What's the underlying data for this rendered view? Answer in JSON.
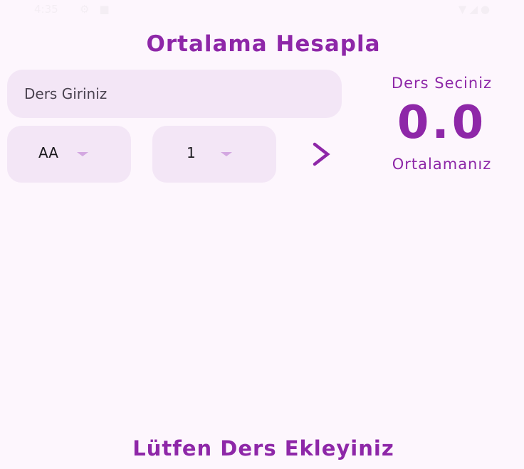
{
  "status_bar": {
    "time": "4:35",
    "icons": [
      "settings-gear-icon",
      "android-robot-icon",
      "wifi-icon",
      "signal-icon",
      "battery-icon"
    ]
  },
  "header": {
    "title": "Ortalama Hesapla"
  },
  "form": {
    "course_placeholder": "Ders Giriniz",
    "grade_selected": "AA",
    "credit_selected": "1"
  },
  "summary": {
    "select_label": "Ders Seciniz",
    "average_value": "0.0",
    "average_label": "Ortalamanız"
  },
  "list": {
    "empty_message": "Lütfen Ders Ekleyiniz"
  },
  "colors": {
    "accent": "#8e27a8",
    "field_background": "#f3e6f6",
    "page_background": "#fdf6fd",
    "caret": "#d3a7e1"
  }
}
